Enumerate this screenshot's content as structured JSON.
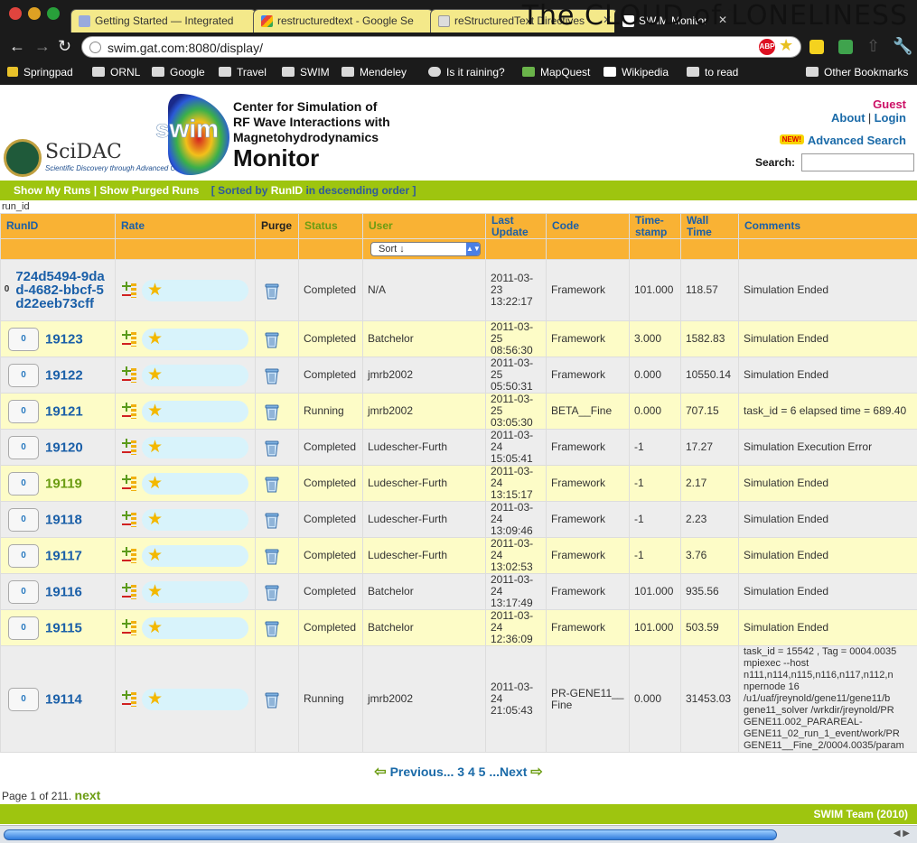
{
  "browser": {
    "tabs": [
      {
        "title": "Getting Started — Integrated",
        "active": false
      },
      {
        "title": "restructuredtext - Google Se",
        "active": false
      },
      {
        "title": "reStructuredText Directives",
        "active": false
      },
      {
        "title": "SWIM Monitor",
        "active": true
      }
    ],
    "banner_text": "The CLOUD of LONELINESS",
    "url": "swim.gat.com:8080/display/",
    "bookmarks": [
      "Springpad",
      "ORNL",
      "Google",
      "Travel",
      "SWIM",
      "Mendeley",
      "Is it raining?",
      "MapQuest",
      "Wikipedia",
      "to read"
    ],
    "other_bookmarks": "Other Bookmarks"
  },
  "header": {
    "scidac_name": "SciDAC",
    "scidac_tagline": "Scientific Discovery through Advanced Computing",
    "logo_text": "swim",
    "title_lines": [
      "Center for Simulation of",
      "RF Wave Interactions with",
      "Magnetohydrodynamics"
    ],
    "monitor": "Monitor",
    "guest": "Guest",
    "about": "About",
    "login": "Login",
    "separator": "|",
    "new_badge": "NEW!",
    "advanced_search": "Advanced Search",
    "search_label": "Search:"
  },
  "menu": {
    "show_my_runs": "Show My Runs",
    "separator": "|",
    "show_purged_runs": "Show Purged Runs",
    "sort_open": "[ Sorted by",
    "sort_field": "RunID",
    "sort_close": "in descending order ]"
  },
  "runid_label": "run_id",
  "table": {
    "headers": {
      "runid": "RunID",
      "rate": "Rate",
      "purge": "Purge",
      "status": "Status",
      "user": "User",
      "last_update": "Last Update",
      "code": "Code",
      "timestamp": "Time-stamp",
      "walltime": "Wall Time",
      "comments": "Comments"
    },
    "user_filter": "Sort ↓",
    "rows": [
      {
        "comments_count": "0",
        "runid": "724d5494-9dad-4682-bbcf-5d22eeb73cff",
        "status": "Completed",
        "user": "N/A",
        "last_update": "2011-03-23 13:22:17",
        "code": "Framework",
        "timestamp": "101.000",
        "walltime": "118.57",
        "comment": "Simulation Ended"
      },
      {
        "comments_count": "0",
        "runid": "19123",
        "status": "Completed",
        "user": "Batchelor",
        "last_update": "2011-03-25 08:56:30",
        "code": "Framework",
        "timestamp": "3.000",
        "walltime": "1582.83",
        "comment": "Simulation Ended"
      },
      {
        "comments_count": "0",
        "runid": "19122",
        "status": "Completed",
        "user": "jmrb2002",
        "last_update": "2011-03-25 05:50:31",
        "code": "Framework",
        "timestamp": "0.000",
        "walltime": "10550.14",
        "comment": "Simulation Ended"
      },
      {
        "comments_count": "0",
        "runid": "19121",
        "status": "Running",
        "user": "jmrb2002",
        "last_update": "2011-03-25 03:05:30",
        "code": "BETA__Fine",
        "timestamp": "0.000",
        "walltime": "707.15",
        "comment": "task_id = 6 elapsed time = 689.40"
      },
      {
        "comments_count": "0",
        "runid": "19120",
        "status": "Completed",
        "user": "Ludescher-Furth",
        "last_update": "2011-03-24 15:05:41",
        "code": "Framework",
        "timestamp": "-1",
        "walltime": "17.27",
        "comment": "Simulation Execution Error"
      },
      {
        "comments_count": "0",
        "runid": "19119",
        "status": "Completed",
        "user": "Ludescher-Furth",
        "last_update": "2011-03-24 13:15:17",
        "code": "Framework",
        "timestamp": "-1",
        "walltime": "2.17",
        "comment": "Simulation Ended"
      },
      {
        "comments_count": "0",
        "runid": "19118",
        "status": "Completed",
        "user": "Ludescher-Furth",
        "last_update": "2011-03-24 13:09:46",
        "code": "Framework",
        "timestamp": "-1",
        "walltime": "2.23",
        "comment": "Simulation Ended"
      },
      {
        "comments_count": "0",
        "runid": "19117",
        "status": "Completed",
        "user": "Ludescher-Furth",
        "last_update": "2011-03-24 13:02:53",
        "code": "Framework",
        "timestamp": "-1",
        "walltime": "3.76",
        "comment": "Simulation Ended"
      },
      {
        "comments_count": "0",
        "runid": "19116",
        "status": "Completed",
        "user": "Batchelor",
        "last_update": "2011-03-24 13:17:49",
        "code": "Framework",
        "timestamp": "101.000",
        "walltime": "935.56",
        "comment": "Simulation Ended"
      },
      {
        "comments_count": "0",
        "runid": "19115",
        "status": "Completed",
        "user": "Batchelor",
        "last_update": "2011-03-24 12:36:09",
        "code": "Framework",
        "timestamp": "101.000",
        "walltime": "503.59",
        "comment": "Simulation Ended"
      },
      {
        "comments_count": "0",
        "runid": "19114",
        "status": "Running",
        "user": "jmrb2002",
        "last_update": "2011-03-24 21:05:43",
        "code": "PR-GENE11__Fine",
        "timestamp": "0.000",
        "walltime": "31453.03",
        "comment_lines": [
          "task_id = 15542 , Tag = 0004.0035",
          "mpiexec --host",
          "n111,n114,n115,n116,n117,n112,n",
          "npernode 16",
          "/u1/uaf/jreynold/gene11/gene11/b",
          "gene11_solver /wrkdir/jreynold/PR",
          "GENE11.002_PARAREAL-",
          "GENE11_02_run_1_event/work/PR",
          "GENE11__Fine_2/0004.0035/param"
        ]
      }
    ]
  },
  "pager": {
    "previous": "Previous",
    "ellipsis_before": "...",
    "pages": [
      "3",
      "4",
      "5"
    ],
    "ellipsis_after": "...",
    "next": "Next",
    "info": "Page 1 of 211.",
    "next_small": "next"
  },
  "footer": "SWIM Team (2010)",
  "colors": {
    "menu_green": "#9ec50f",
    "header_orange": "#f9b234",
    "row_yellow": "#fdfcc7",
    "row_gray": "#ededed",
    "link_blue": "#1a5fa8",
    "status_green": "#6b9c12"
  }
}
